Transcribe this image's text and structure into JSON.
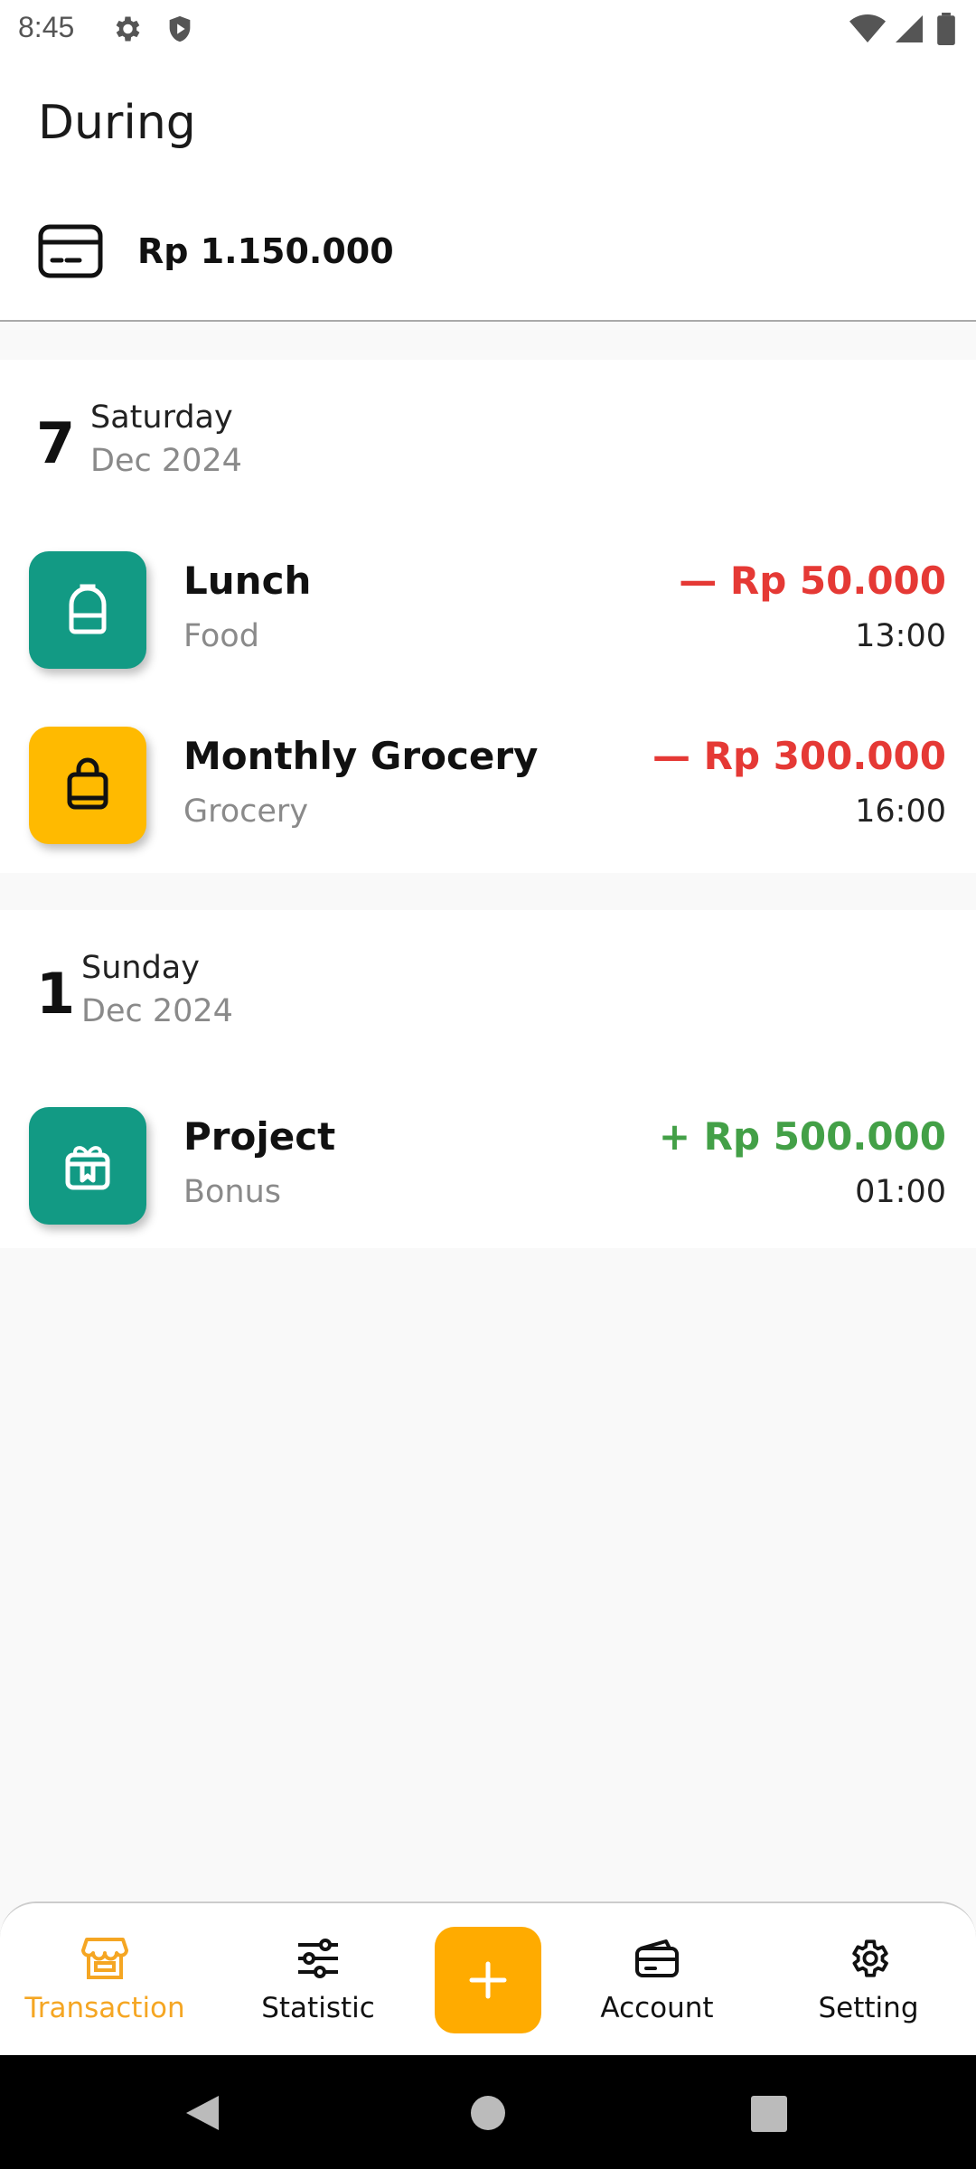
{
  "status_bar": {
    "time": "8:45"
  },
  "header": {
    "title": "During",
    "balance": "Rp 1.150.000"
  },
  "groups": [
    {
      "day_number": "7",
      "day_name": "Saturday",
      "month_year": "Dec 2024",
      "transactions": [
        {
          "title": "Lunch",
          "category": "Food",
          "amount": "— Rp 50.000",
          "time": "13:00",
          "type": "expense",
          "icon": "backpack-icon",
          "icon_color": "#129a84"
        },
        {
          "title": "Monthly Grocery",
          "category": "Grocery",
          "amount": "— Rp 300.000",
          "time": "16:00",
          "type": "expense",
          "icon": "shopping-bag-icon",
          "icon_color": "#ffba00"
        }
      ]
    },
    {
      "day_number": "1",
      "day_name": "Sunday",
      "month_year": "Dec 2024",
      "transactions": [
        {
          "title": "Project",
          "category": "Bonus",
          "amount": "+ Rp 500.000",
          "time": "01:00",
          "type": "income",
          "icon": "gift-icon",
          "icon_color": "#129a84"
        }
      ]
    }
  ],
  "colors": {
    "expense": "#e53935",
    "income": "#43a047",
    "accent": "#f5a623",
    "fab": "#ffab00"
  },
  "bottom_nav": {
    "items": [
      {
        "label": "Transaction",
        "icon": "store-icon",
        "active": true
      },
      {
        "label": "Statistic",
        "icon": "sliders-icon",
        "active": false
      },
      {
        "label": "Account",
        "icon": "wallet-icon",
        "active": false
      },
      {
        "label": "Setting",
        "icon": "settings-icon",
        "active": false
      }
    ],
    "fab_icon": "plus-icon"
  }
}
